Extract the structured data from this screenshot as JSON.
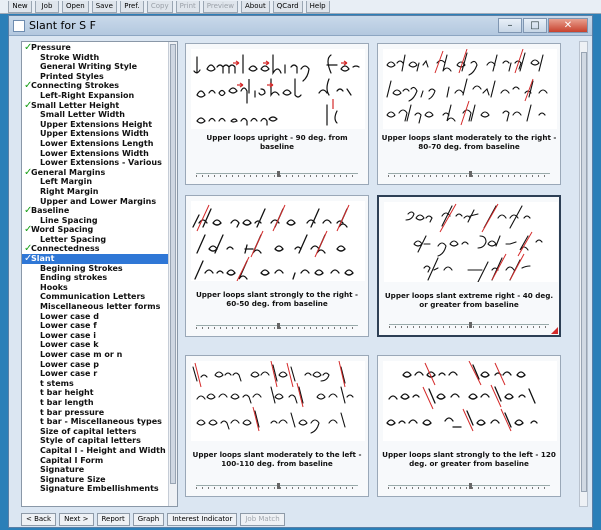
{
  "toolbar": {
    "buttons": [
      {
        "label": "New",
        "enabled": true
      },
      {
        "label": "Job",
        "enabled": true
      },
      {
        "label": "Open",
        "enabled": true
      },
      {
        "label": "Save",
        "enabled": true
      },
      {
        "label": "Pref.",
        "enabled": true
      },
      {
        "label": "Copy",
        "enabled": false
      },
      {
        "label": "Print",
        "enabled": false
      },
      {
        "label": "Preview",
        "enabled": false
      },
      {
        "label": "About",
        "enabled": true
      },
      {
        "label": "QCard",
        "enabled": true
      },
      {
        "label": "Help",
        "enabled": true
      }
    ]
  },
  "window": {
    "title": "Slant for S F",
    "minimize": "–",
    "maximize": "□",
    "close": "✕"
  },
  "sidebar": {
    "items": [
      {
        "label": "Pressure",
        "checked": true,
        "selected": false
      },
      {
        "label": "Stroke Width",
        "checked": false,
        "selected": false
      },
      {
        "label": "General Writing Style",
        "checked": false,
        "selected": false
      },
      {
        "label": "Printed Styles",
        "checked": false,
        "selected": false
      },
      {
        "label": "Connecting Strokes",
        "checked": true,
        "selected": false
      },
      {
        "label": "Left-Right Expansion",
        "checked": false,
        "selected": false
      },
      {
        "label": "Small Letter Height",
        "checked": true,
        "selected": false
      },
      {
        "label": "Small Letter Width",
        "checked": false,
        "selected": false
      },
      {
        "label": "Upper Extensions Height",
        "checked": false,
        "selected": false
      },
      {
        "label": "Upper Extensions Width",
        "checked": false,
        "selected": false
      },
      {
        "label": "Lower Extensions Length",
        "checked": false,
        "selected": false
      },
      {
        "label": "Lower Extensions Width",
        "checked": false,
        "selected": false
      },
      {
        "label": "Lower Extensions - Various",
        "checked": false,
        "selected": false
      },
      {
        "label": "General Margins",
        "checked": true,
        "selected": false
      },
      {
        "label": "Left Margin",
        "checked": false,
        "selected": false
      },
      {
        "label": "Right Margin",
        "checked": false,
        "selected": false
      },
      {
        "label": "Upper and Lower Margins",
        "checked": false,
        "selected": false
      },
      {
        "label": "Baseline",
        "checked": true,
        "selected": false
      },
      {
        "label": "Line Spacing",
        "checked": false,
        "selected": false
      },
      {
        "label": "Word Spacing",
        "checked": true,
        "selected": false
      },
      {
        "label": "Letter Spacing",
        "checked": false,
        "selected": false
      },
      {
        "label": "Connectedness",
        "checked": true,
        "selected": false
      },
      {
        "label": "Slant",
        "checked": true,
        "selected": true
      },
      {
        "label": "Beginning Strokes",
        "checked": false,
        "selected": false
      },
      {
        "label": "Ending strokes",
        "checked": false,
        "selected": false
      },
      {
        "label": "Hooks",
        "checked": false,
        "selected": false
      },
      {
        "label": "Communication Letters",
        "checked": false,
        "selected": false
      },
      {
        "label": "Miscellaneous letter forms",
        "checked": false,
        "selected": false
      },
      {
        "label": "Lower case d",
        "checked": false,
        "selected": false
      },
      {
        "label": "Lower case f",
        "checked": false,
        "selected": false
      },
      {
        "label": "Lower case i",
        "checked": false,
        "selected": false
      },
      {
        "label": "Lower case k",
        "checked": false,
        "selected": false
      },
      {
        "label": "Lower case m or n",
        "checked": false,
        "selected": false
      },
      {
        "label": "Lower case p",
        "checked": false,
        "selected": false
      },
      {
        "label": "Lower case r",
        "checked": false,
        "selected": false
      },
      {
        "label": "t stems",
        "checked": false,
        "selected": false
      },
      {
        "label": "t bar height",
        "checked": false,
        "selected": false
      },
      {
        "label": "t bar length",
        "checked": false,
        "selected": false
      },
      {
        "label": "t bar pressure",
        "checked": false,
        "selected": false
      },
      {
        "label": "t bar - Miscellaneous types",
        "checked": false,
        "selected": false
      },
      {
        "label": "Size of capital letters",
        "checked": false,
        "selected": false
      },
      {
        "label": "Style of capital letters",
        "checked": false,
        "selected": false
      },
      {
        "label": "Capital I - Height and Width",
        "checked": false,
        "selected": false
      },
      {
        "label": "Capital I Form",
        "checked": false,
        "selected": false
      },
      {
        "label": "Signature",
        "checked": false,
        "selected": false
      },
      {
        "label": "Signature Size",
        "checked": false,
        "selected": false
      },
      {
        "label": "Signature Embellishments",
        "checked": false,
        "selected": false
      }
    ]
  },
  "cards": [
    {
      "caption": "Upper loops upright - 90 deg. from baseline",
      "selected": false
    },
    {
      "caption": "Upper loops slant moderately to the right - 80-70 deg. from baseline",
      "selected": false
    },
    {
      "caption": "Upper loops slant strongly to the right - 60-50 deg. from baseline",
      "selected": false
    },
    {
      "caption": "Upper loops slant extreme right - 40 deg. or greater from baseline",
      "selected": true
    },
    {
      "caption": "Upper loops slant moderately to the left - 100-110 deg. from baseline",
      "selected": false
    },
    {
      "caption": "Upper loops slant strongly to the left - 120 deg. or greater from baseline",
      "selected": false
    }
  ],
  "bottom": {
    "back": "< Back",
    "next": "Next >",
    "report": "Report",
    "graph": "Graph",
    "interest": "Interest Indicator",
    "jobmatch": "Job Match"
  },
  "colors": {
    "selection": "#2f77d6",
    "check": "#19a019",
    "ink": "#111111",
    "marker": "#d42a2a"
  }
}
